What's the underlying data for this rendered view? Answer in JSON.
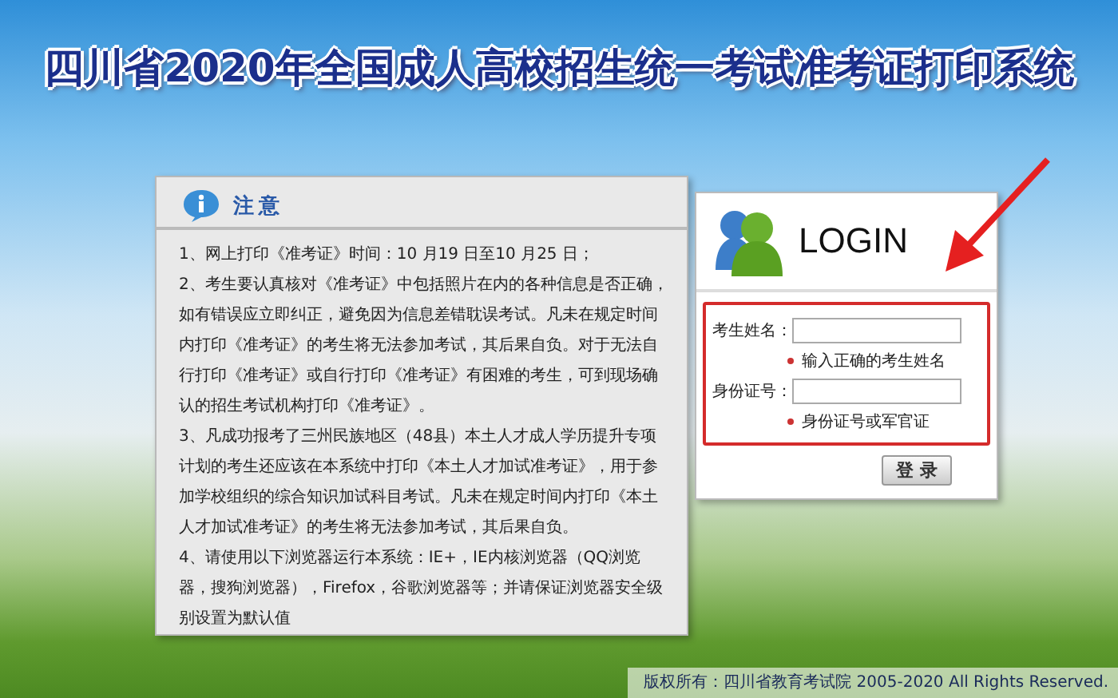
{
  "header": {
    "title": "四川省2020年全国成人高校招生统一考试准考证打印系统"
  },
  "notice": {
    "title": "注意",
    "items": [
      "1、网上打印《准考证》时间：10 月19 日至10 月25 日；",
      "2、考生要认真核对《准考证》中包括照片在内的各种信息是否正确，如有错误应立即纠正，避免因为信息差错耽误考试。凡未在规定时间内打印《准考证》的考生将无法参加考试，其后果自负。对于无法自行打印《准考证》或自行打印《准考证》有困难的考生，可到现场确认的招生考试机构打印《准考证》。",
      "3、凡成功报考了三州民族地区（48县）本土人才成人学历提升专项计划的考生还应该在本系统中打印《本土人才加试准考证》，用于参加学校组织的综合知识加试科目考试。凡未在规定时间内打印《本土人才加试准考证》的考生将无法参加考试，其后果自负。",
      "4、请使用以下浏览器运行本系统：IE+，IE内核浏览器（QQ浏览器，搜狗浏览器），Firefox，谷歌浏览器等；并请保证浏览器安全级别设置为默认值"
    ]
  },
  "login": {
    "title": "LOGIN",
    "fields": [
      {
        "label": "考生姓名：",
        "hint": "输入正确的考生姓名"
      },
      {
        "label": "身份证号：",
        "hint": "身份证号或军官证"
      }
    ],
    "button": "登 录"
  },
  "footer": {
    "text": "版权所有：四川省教育考试院 2005-2020 All Rights Reserved."
  }
}
